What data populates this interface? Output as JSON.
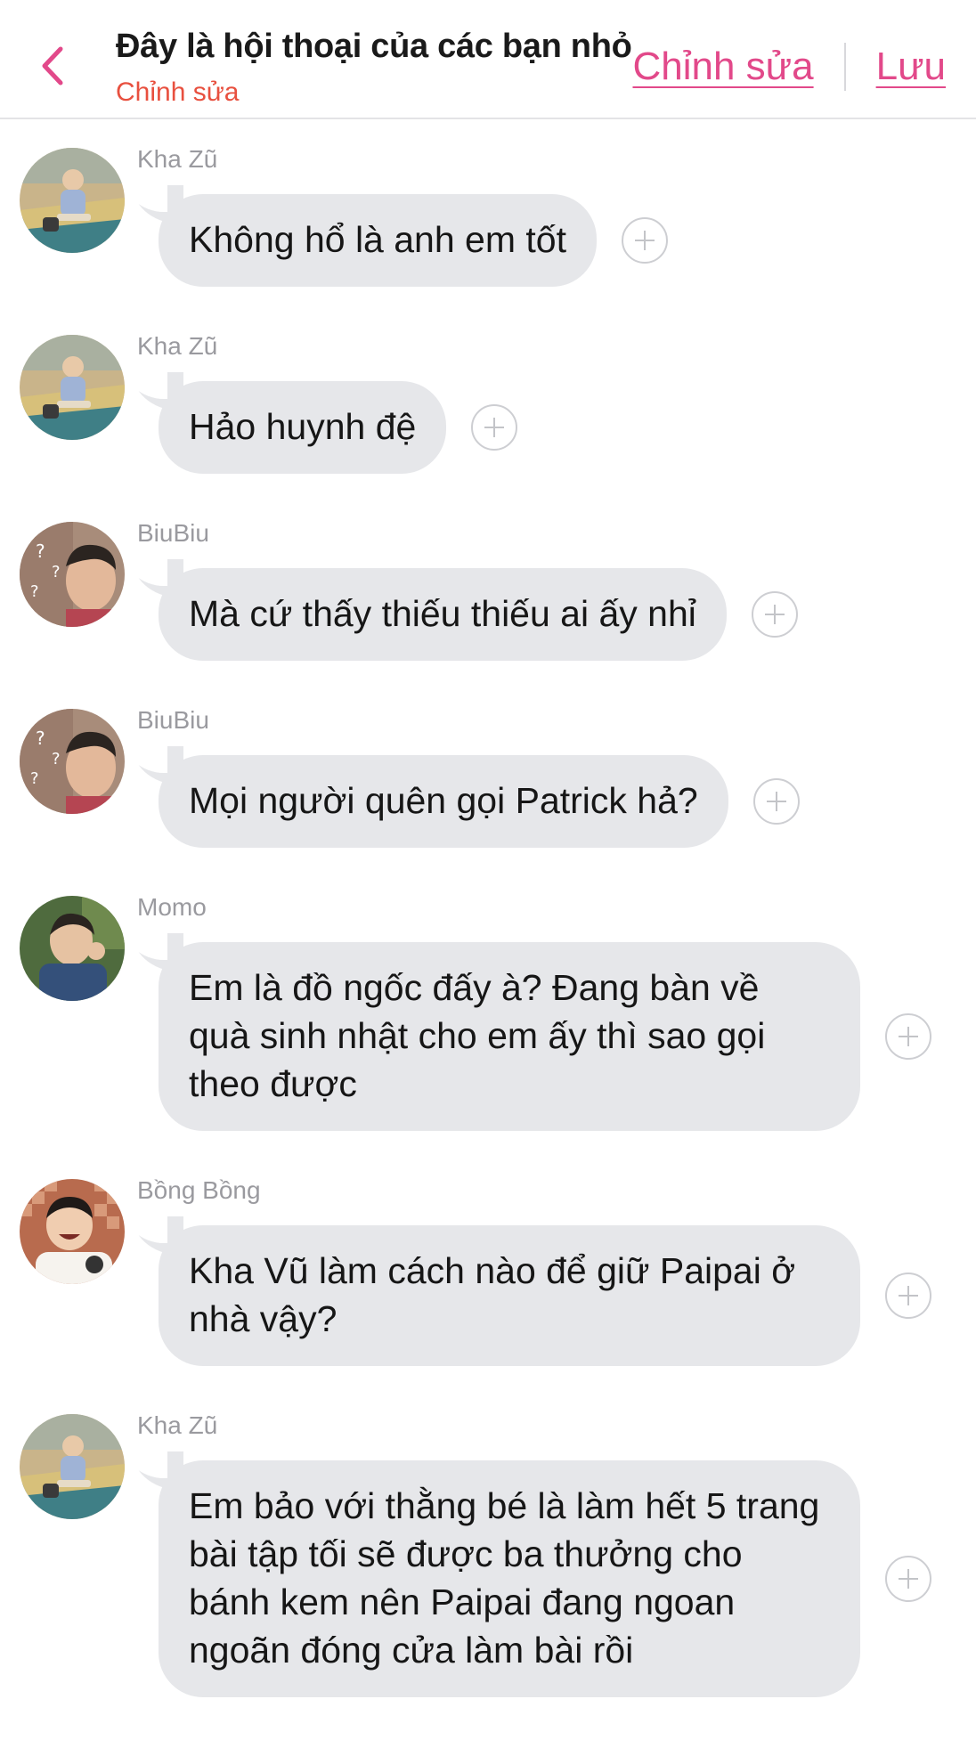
{
  "header": {
    "title": "Đây là hội thoại của các bạn nhỏ",
    "subtitle": "Chỉnh sửa",
    "edit_label": "Chỉnh sửa",
    "save_label": "Lưu"
  },
  "colors": {
    "accent": "#e2498a",
    "subtitle": "#e8503f",
    "bubble": "#e6e7ea",
    "sender": "#9a9a9f"
  },
  "messages": [
    {
      "sender": "Kha Zũ",
      "text": "Không hổ là anh em tốt"
    },
    {
      "sender": "Kha Zũ",
      "text": "Hảo huynh đệ"
    },
    {
      "sender": "BiuBiu",
      "text": "Mà cứ thấy thiếu thiếu ai ấy nhỉ"
    },
    {
      "sender": "BiuBiu",
      "text": "Mọi người quên gọi Patrick hả?"
    },
    {
      "sender": "Momo",
      "text": "Em là đồ ngốc đấy à? Đang bàn về quà sinh nhật cho em ấy thì sao gọi theo được"
    },
    {
      "sender": "Bồng Bồng",
      "text": "Kha Vũ làm cách nào để giữ Paipai ở nhà vậy?"
    },
    {
      "sender": "Kha Zũ",
      "text": "Em bảo với thằng bé là làm hết 5 trang bài tập tối sẽ được ba thưởng cho bánh kem nên Paipai đang ngoan ngoãn đóng cửa làm bài rồi"
    }
  ]
}
